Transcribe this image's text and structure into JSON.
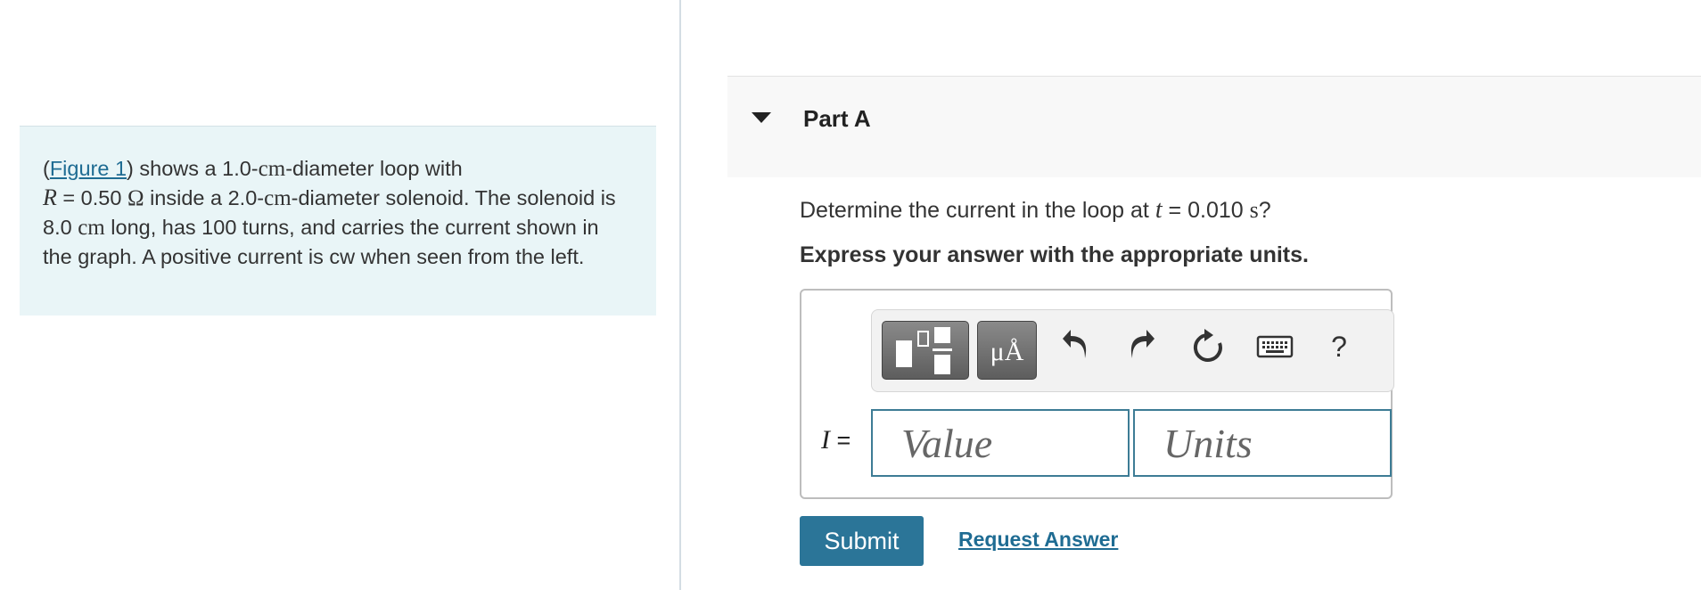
{
  "problem": {
    "open_paren": "(",
    "figure_link": "Figure 1",
    "seg1": ") shows a 1.0-",
    "unit_cm1": "cm",
    "seg2": "-diameter loop with",
    "var_R": "R",
    "seg3": " = 0.50 ",
    "unit_ohm": "Ω",
    "seg4": " inside a 2.0-",
    "unit_cm2": "cm",
    "seg5": "-diameter solenoid. The solenoid is 8.0 ",
    "unit_cm3": "cm",
    "seg6": " long, has 100 turns, and carries the current shown in the graph. A positive current is cw when seen from the left."
  },
  "part": {
    "title": "Part A"
  },
  "question": {
    "text_before": "Determine the current in the loop at ",
    "var_t": "t",
    "text_eq": " = 0.010 ",
    "unit_s": "s",
    "text_after": "?"
  },
  "instruction": "Express your answer with the appropriate units.",
  "toolbar": {
    "units_label": "μÅ",
    "help_label": "?",
    "tools": [
      "templates-icon",
      "units-icon",
      "undo-icon",
      "redo-icon",
      "reset-icon",
      "keyboard-icon",
      "help-icon"
    ]
  },
  "answer": {
    "variable": "I",
    "equals": " =",
    "value_placeholder": "Value",
    "units_placeholder": "Units"
  },
  "buttons": {
    "submit": "Submit",
    "request": "Request Answer"
  },
  "colors": {
    "accent": "#2b7598",
    "link": "#1f6c93",
    "panel": "#e9f5f7"
  }
}
